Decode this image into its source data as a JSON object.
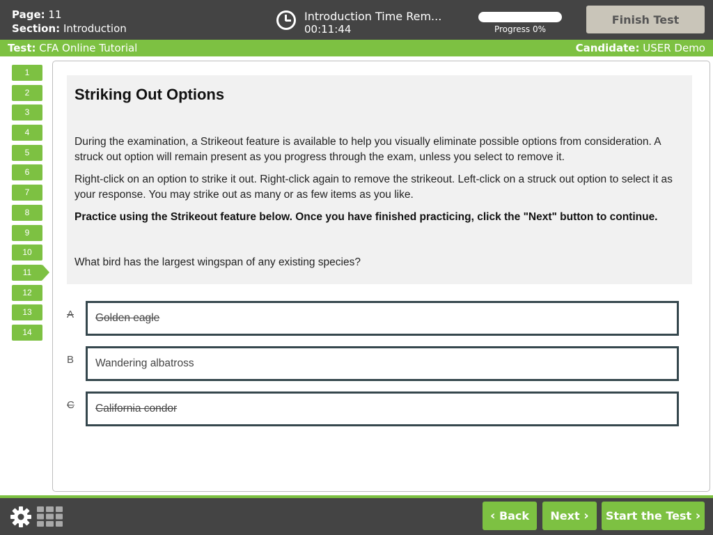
{
  "header": {
    "page_label": "Page:",
    "page_value": "11",
    "section_label": "Section:",
    "section_value": "Introduction",
    "timer_title": "Introduction Time Rem...",
    "timer_value": "00:11:44",
    "progress_text": "Progress 0%",
    "progress_fraction": 0,
    "finish_label": "Finish Test"
  },
  "subheader": {
    "test_label": "Test:",
    "test_value": "CFA Online Tutorial",
    "candidate_label": "Candidate:",
    "candidate_value": "USER Demo"
  },
  "nav": {
    "items": [
      "1",
      "2",
      "3",
      "4",
      "5",
      "6",
      "7",
      "8",
      "9",
      "10",
      "11",
      "12",
      "13",
      "14"
    ],
    "current": "11"
  },
  "question": {
    "title": "Striking Out Options",
    "para1": "During the examination, a Strikeout feature is available to help you visually eliminate possible options from consideration. A struck out option will remain present as you progress through the exam, unless you select to remove it.",
    "para2": "Right-click on an option to strike it out. Right-click again to remove the strikeout. Left-click on a struck out option to select it as your response. You may strike out as many or as few items as you like.",
    "para3": "Practice using the Strikeout feature below. Once you have finished practicing, click the \"Next\" button to continue.",
    "prompt": "What bird has the largest wingspan of any existing species?"
  },
  "options": [
    {
      "letter": "A",
      "text": "Golden eagle",
      "struck": true
    },
    {
      "letter": "B",
      "text": "Wandering albatross",
      "struck": false
    },
    {
      "letter": "C",
      "text": "California condor",
      "struck": true
    }
  ],
  "footer": {
    "back_label": "Back",
    "next_label": "Next",
    "start_label": "Start the Test",
    "icons": [
      "gear-icon",
      "grid-icon"
    ]
  },
  "colors": {
    "accent_green": "#7dc142",
    "header_dark": "#444444",
    "option_border": "#35474d",
    "finish_button": "#c9c5b9"
  }
}
